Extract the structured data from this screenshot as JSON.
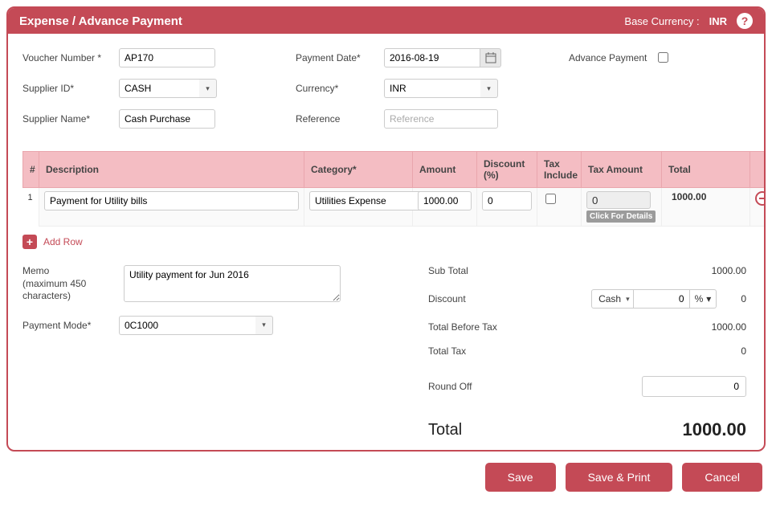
{
  "header": {
    "title": "Expense / Advance Payment",
    "base_currency_label": "Base Currency :",
    "base_currency_value": "INR",
    "help": "?"
  },
  "form": {
    "voucher_label": "Voucher Number *",
    "voucher_value": "AP170",
    "supplier_id_label": "Supplier ID*",
    "supplier_id_value": "CASH",
    "supplier_name_label": "Supplier Name*",
    "supplier_name_value": "Cash Purchase",
    "payment_date_label": "Payment Date*",
    "payment_date_value": "2016-08-19",
    "currency_label": "Currency*",
    "currency_value": "INR",
    "reference_label": "Reference",
    "reference_placeholder": "Reference",
    "reference_value": "",
    "advance_label": "Advance Payment",
    "advance_checked": false
  },
  "grid": {
    "headers": {
      "num": "#",
      "desc": "Description",
      "cat": "Category*",
      "amt": "Amount",
      "disc": "Discount (%)",
      "taxinc": "Tax Include",
      "taxamt": "Tax Amount",
      "total": "Total"
    },
    "rows": [
      {
        "idx": "1",
        "description": "Payment for Utility bills",
        "category": "Utilities Expense",
        "amount": "1000.00",
        "discount": "0",
        "tax_include": false,
        "tax_amount": "0",
        "tax_hint": "Click For Details",
        "total": "1000.00"
      }
    ],
    "add_row_label": "Add Row"
  },
  "memo": {
    "label_line1": "Memo",
    "label_line2": "(maximum 450 characters)",
    "value": "Utility payment for Jun 2016"
  },
  "payment_mode": {
    "label": "Payment Mode*",
    "value": "0C1000"
  },
  "summary": {
    "subtotal_label": "Sub Total",
    "subtotal_value": "1000.00",
    "discount_label": "Discount",
    "discount_type": "Cash",
    "discount_amount": "0",
    "discount_unit": "%",
    "discount_result": "0",
    "tbt_label": "Total Before Tax",
    "tbt_value": "1000.00",
    "totaltax_label": "Total Tax",
    "totaltax_value": "0",
    "roundoff_label": "Round Off",
    "roundoff_value": "0",
    "total_label": "Total",
    "total_value": "1000.00"
  },
  "actions": {
    "save": "Save",
    "save_print": "Save & Print",
    "cancel": "Cancel"
  }
}
